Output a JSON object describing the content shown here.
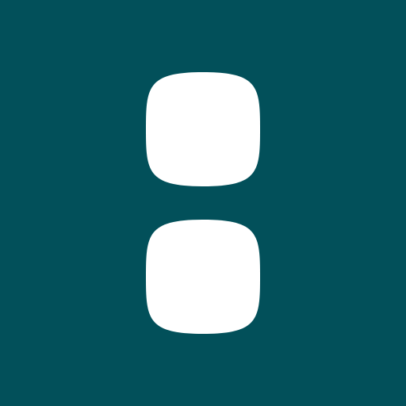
{
  "icon": {
    "name": "two-squircles-logo-icon",
    "background_color": "#02505A",
    "shape_color": "#FFFFFF"
  }
}
